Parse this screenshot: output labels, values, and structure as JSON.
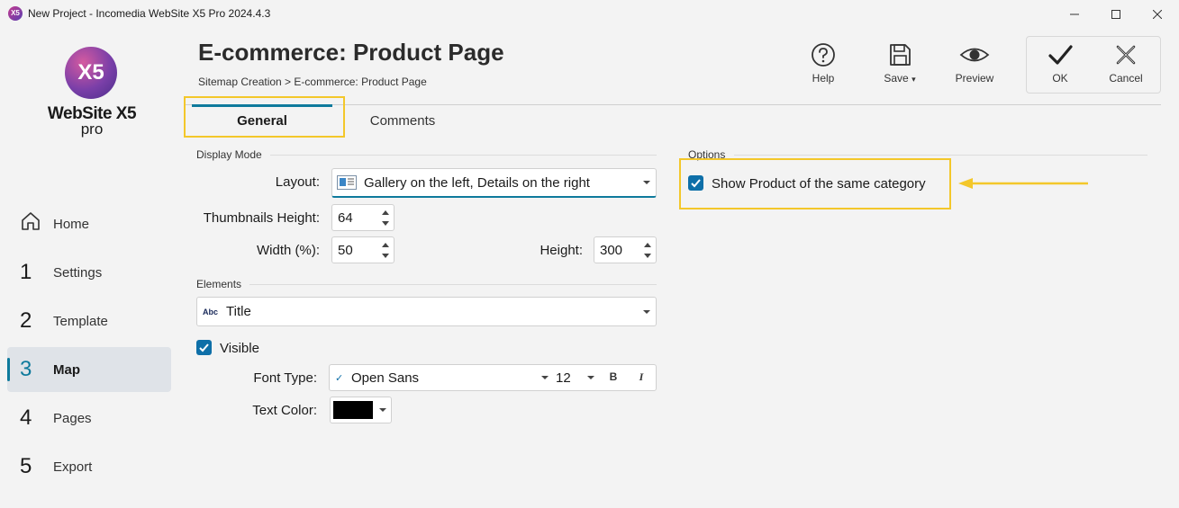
{
  "window": {
    "app_icon_text": "X5",
    "title": "New Project - Incomedia WebSite X5 Pro 2024.4.3"
  },
  "logo": {
    "mark": "X5",
    "name": "WebSite X5",
    "edition": "pro"
  },
  "sidebar": {
    "items": [
      {
        "num": "",
        "label": "Home",
        "icon": "home-icon"
      },
      {
        "num": "1",
        "label": "Settings"
      },
      {
        "num": "2",
        "label": "Template"
      },
      {
        "num": "3",
        "label": "Map",
        "active": true
      },
      {
        "num": "4",
        "label": "Pages"
      },
      {
        "num": "5",
        "label": "Export"
      }
    ]
  },
  "header": {
    "title": "E-commerce: Product Page",
    "breadcrumb": "Sitemap Creation > E-commerce: Product Page"
  },
  "toolbar": {
    "help": "Help",
    "save": "Save",
    "save_caret": "▾",
    "preview": "Preview",
    "ok": "OK",
    "cancel": "Cancel"
  },
  "tabs": [
    {
      "label": "General",
      "active": true
    },
    {
      "label": "Comments"
    }
  ],
  "display_mode": {
    "group_label": "Display Mode",
    "layout_label": "Layout:",
    "layout_value": "Gallery on the left, Details on the right",
    "thumb_height_label": "Thumbnails Height:",
    "thumb_height_value": "64",
    "width_label": "Width (%):",
    "width_value": "50",
    "height_label": "Height:",
    "height_value": "300"
  },
  "elements": {
    "group_label": "Elements",
    "element_icon_text": "Abc",
    "element_value": "Title",
    "visible_label": "Visible",
    "visible_checked": true,
    "font_type_label": "Font Type:",
    "font_value": "Open Sans",
    "font_size": "12",
    "bold_label": "B",
    "italic_label": "I",
    "text_color_label": "Text Color:",
    "text_color": "#000000"
  },
  "options": {
    "group_label": "Options",
    "show_same_category_label": "Show Product of the same category",
    "show_same_category_checked": true
  },
  "annotations": {
    "highlight_color": "#f3c72a"
  },
  "colors": {
    "accent": "#0e7a9c",
    "checkbox": "#0e6fa8"
  }
}
